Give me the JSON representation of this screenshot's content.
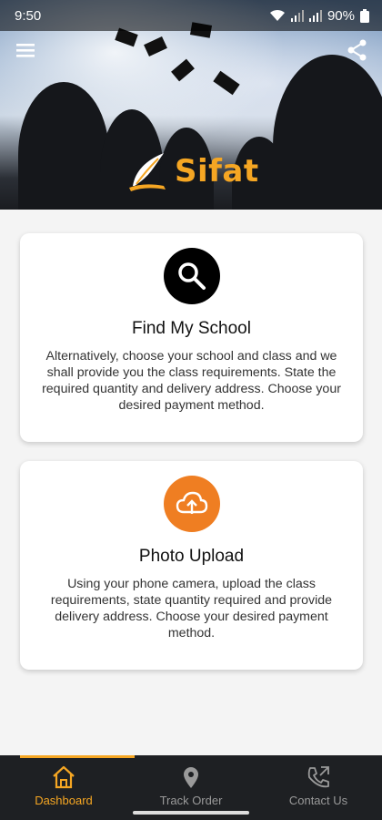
{
  "status_bar": {
    "time": "9:50",
    "battery": "90%"
  },
  "header": {
    "brand": "Sifat",
    "brand_color": "#f5a623"
  },
  "cards": [
    {
      "title": "Find My School",
      "description": "Alternatively, choose your school and class and we shall provide you the class requirements. State the required quantity and delivery address. Choose your desired payment method.",
      "icon": "search-icon"
    },
    {
      "title": "Photo Upload",
      "description": "Using your phone camera, upload the class requirements, state quantity required and provide delivery address. Choose your desired payment method.",
      "icon": "cloud-upload-icon",
      "icon_bg": "#ef7e22"
    }
  ],
  "bottom_nav": {
    "items": [
      {
        "label": "Dashboard",
        "icon": "home-icon",
        "active": true
      },
      {
        "label": "Track Order",
        "icon": "location-pin-icon",
        "active": false
      },
      {
        "label": "Contact Us",
        "icon": "phone-icon",
        "active": false
      }
    ]
  }
}
